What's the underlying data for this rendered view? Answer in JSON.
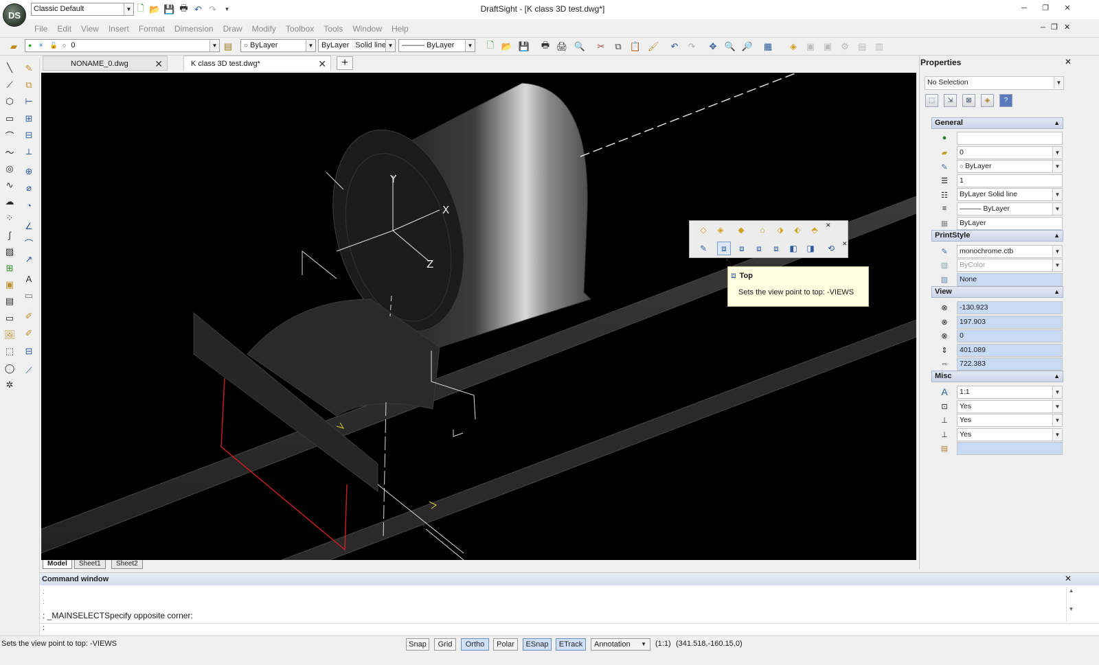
{
  "app": {
    "window_title": "DraftSight - [K class 3D test.dwg*]",
    "logo_text": "DS",
    "workspace": "Classic Default",
    "menus": [
      "File",
      "Edit",
      "View",
      "Insert",
      "Format",
      "Dimension",
      "Draw",
      "Modify",
      "Toolbox",
      "Tools",
      "Window",
      "Help"
    ]
  },
  "toolbar": {
    "layer_value": "0",
    "color_value": "ByLayer",
    "linestyle_by": "ByLayer",
    "linestyle_value": "Solid line",
    "lineweight_value": "——— ByLayer"
  },
  "tabs": [
    {
      "label": "NONAME_0.dwg",
      "close": "✕"
    },
    {
      "label": "K class 3D test.dwg*",
      "close": "✕"
    }
  ],
  "add_tab": "+",
  "sheet_tabs": [
    "Model",
    "Sheet1",
    "Sheet2"
  ],
  "canvas_axes": {
    "y": "Y",
    "x": "X",
    "z": "Z"
  },
  "properties": {
    "title": "Properties",
    "close": "✕",
    "selection": "No Selection",
    "general": {
      "header": "General",
      "color": "",
      "layer": "0",
      "linecolor": "ByLayer",
      "scale": "1",
      "linestyle": "ByLayer    Solid line",
      "lineweight": "——— ByLayer",
      "transparency": "ByLayer"
    },
    "printstyle": {
      "header": "PrintStyle",
      "table": "monochrome.ctb",
      "style": "ByColor",
      "value": "None"
    },
    "view": {
      "header": "View",
      "center_x": "-130.923",
      "center_y": "197.903",
      "center_z": "0",
      "height": "401.089",
      "width": "722.383"
    },
    "misc": {
      "header": "Misc",
      "annotation_scale": "1:1",
      "ucs_icon_on": "Yes",
      "ucs_icon_origin": "Yes",
      "ucs_per_viewport": "Yes",
      "visual_style": ""
    }
  },
  "tooltip": {
    "title": "Top",
    "description": "Sets the view point to top:  -VIEWS"
  },
  "command": {
    "title": "Command window",
    "close": "✕",
    "line1": ":",
    "line2": ":",
    "line3": ": _MAINSELECTSpecify opposite corner:",
    "prompt": ":"
  },
  "status": {
    "message": "Sets the view point to top:  -VIEWS",
    "buttons": [
      {
        "label": "Snap",
        "on": false
      },
      {
        "label": "Grid",
        "on": false
      },
      {
        "label": "Ortho",
        "on": true
      },
      {
        "label": "Polar",
        "on": false
      },
      {
        "label": "ESnap",
        "on": true
      },
      {
        "label": "ETrack",
        "on": true
      }
    ],
    "annotation": "Annotation",
    "scale": "(1:1)",
    "coords": "(341.518,-160.15,0)"
  }
}
